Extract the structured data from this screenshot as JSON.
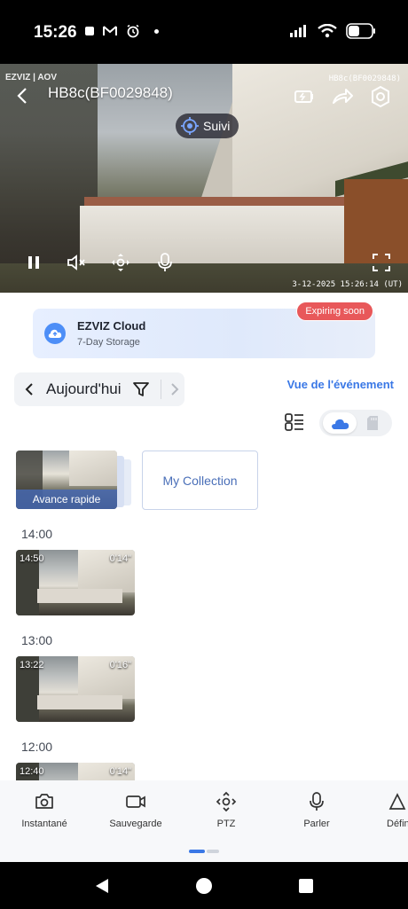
{
  "status_bar": {
    "time": "15:26"
  },
  "camera": {
    "title": "HB8c(BF0029848)",
    "overlay_logo": "EZVIZ | AOV",
    "overlay_id": "HB8c(BF0029848)",
    "overlay_timestamp": "3-12-2025 15:26:14 (UT)",
    "tracking_label": "Suivi"
  },
  "cloud": {
    "title": "EZVIZ Cloud",
    "subtitle": "7-Day Storage",
    "badge": "Expiring soon"
  },
  "timeline": {
    "date_label": "Aujourd'hui",
    "event_view_link": "Vue de l'événement",
    "fast_forward_label": "Avance rapide",
    "collection_label": "My Collection",
    "groups": [
      {
        "hour": "14:00",
        "clip_time": "14:50",
        "duration": "0'14\""
      },
      {
        "hour": "13:00",
        "clip_time": "13:22",
        "duration": "0'16\""
      },
      {
        "hour": "12:00",
        "clip_time": "12:40",
        "duration": "0'14\""
      }
    ]
  },
  "toolbar": {
    "snapshot": "Instantané",
    "record": "Sauvegarde",
    "ptz": "PTZ",
    "talk": "Parler",
    "definition": "Défin"
  },
  "colors": {
    "accent": "#3a78e6",
    "badge": "#e8585a",
    "cloud_icon": "#4d8ef7"
  }
}
